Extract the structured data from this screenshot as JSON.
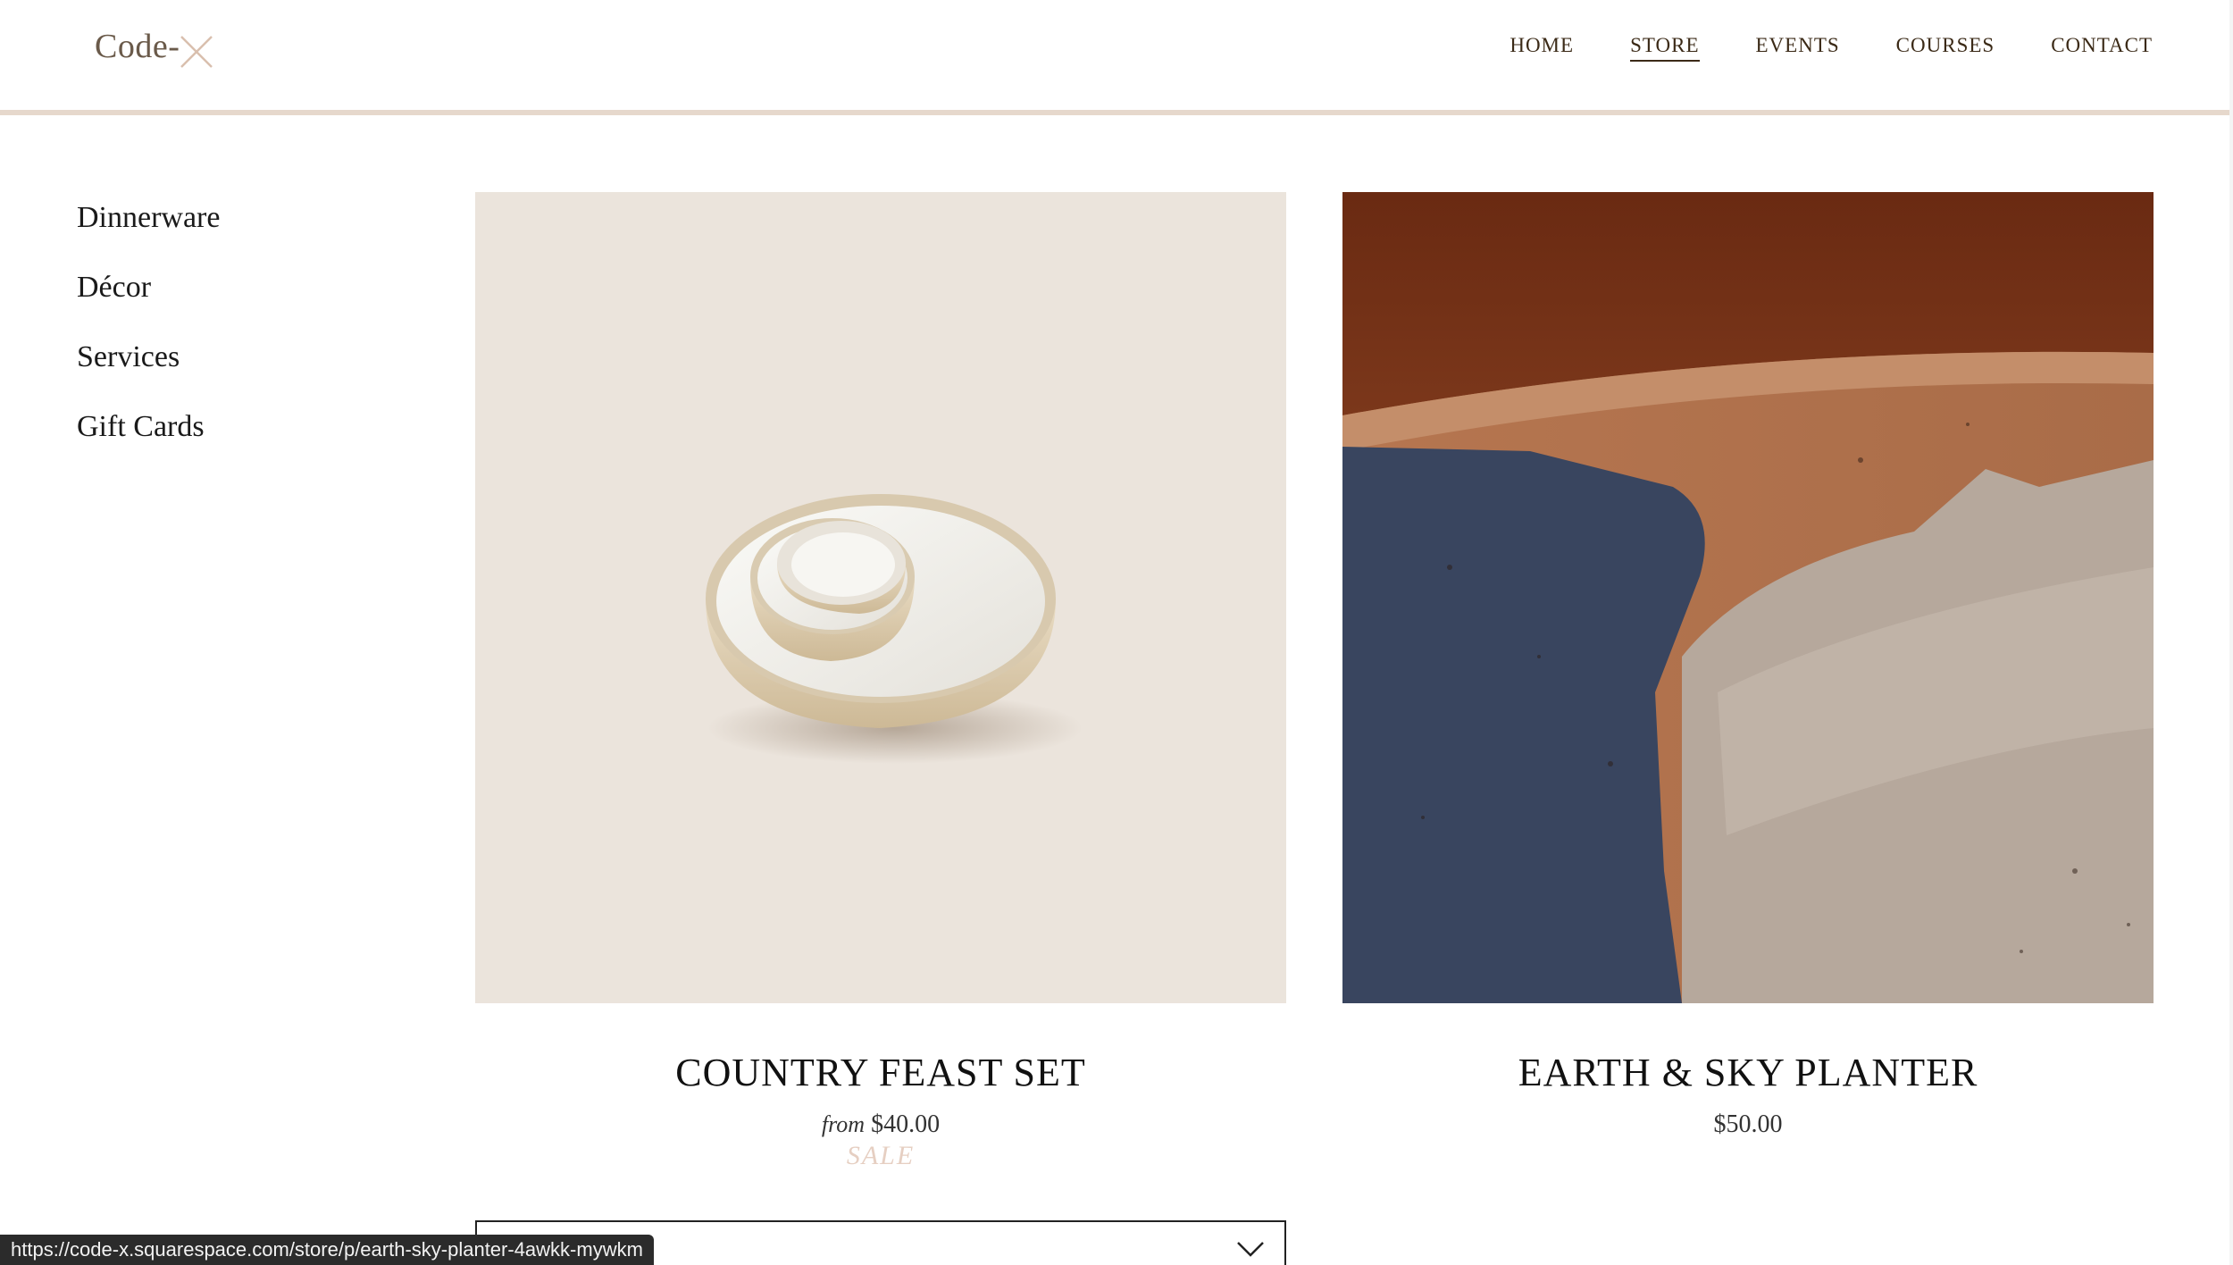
{
  "header": {
    "logo_text": "Code-",
    "nav": [
      {
        "label": "HOME",
        "active": false
      },
      {
        "label": "STORE",
        "active": true
      },
      {
        "label": "EVENTS",
        "active": false
      },
      {
        "label": "COURSES",
        "active": false
      },
      {
        "label": "CONTACT",
        "active": false
      }
    ]
  },
  "sidebar": {
    "items": [
      {
        "label": "Dinnerware"
      },
      {
        "label": "Décor"
      },
      {
        "label": "Services"
      },
      {
        "label": "Gift Cards"
      }
    ]
  },
  "products": [
    {
      "title": "COUNTRY FEAST SET",
      "price_prefix": "from",
      "price": "$40.00",
      "badge": "SALE",
      "image": "stacked-ceramic-bowls"
    },
    {
      "title": "EARTH & SKY PLANTER",
      "price": "$50.00",
      "image": "painted-terracotta-planter"
    }
  ],
  "status_bar": {
    "url": "https://code-x.squarespace.com/store/p/earth-sky-planter-4awkk-mywkm"
  },
  "colors": {
    "header_border": "#e6d8cc",
    "nav_text": "#3b2a17",
    "sale": "#e6cfc2",
    "image_bg": "#ebe4dc"
  }
}
